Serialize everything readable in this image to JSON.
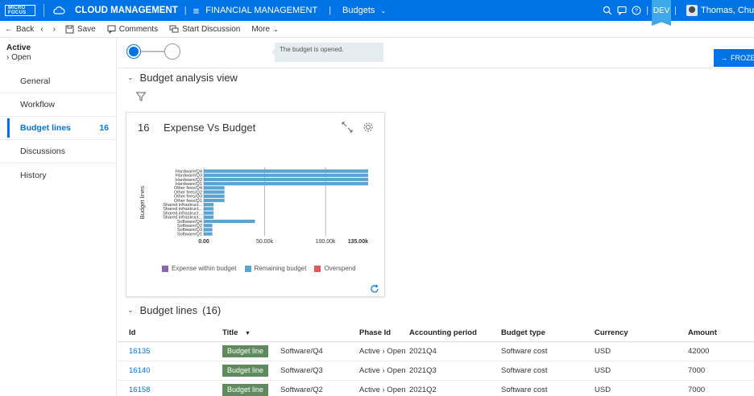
{
  "topbar": {
    "logo_line1": "MICRO",
    "logo_line2": "FOCUS",
    "app_title": "CLOUD MANAGEMENT",
    "module": "FINANCIAL MANAGEMENT",
    "page": "Budgets",
    "env": "DEV",
    "user": "Thomas, Chu",
    "colors": {
      "bar": "#0073e7",
      "env_flag": "#3ea8e8"
    }
  },
  "toolbar": {
    "back": "Back",
    "save": "Save",
    "comments": "Comments",
    "start_discussion": "Start Discussion",
    "more": "More"
  },
  "status": {
    "label": "Active",
    "value": "Open"
  },
  "nav": [
    {
      "label": "General"
    },
    {
      "label": "Workflow"
    },
    {
      "label": "Budget lines",
      "count": "16",
      "active": true
    },
    {
      "label": "Discussions"
    },
    {
      "label": "History"
    }
  ],
  "tooltip": "The budget is opened.",
  "froze_button": "FROZE",
  "analysis": {
    "title": "Budget analysis view"
  },
  "card": {
    "number": "16",
    "title": "Expense Vs Budget"
  },
  "chart_data": {
    "type": "bar",
    "orientation": "horizontal",
    "title": "Expense Vs Budget",
    "ylabel": "Budget lines",
    "categories": [
      "Hardware/Q4",
      "Hardware/Q3",
      "Hardware/Q2",
      "Hardware/Q1",
      "Other fees/Q4",
      "Other fees/Q2",
      "Other fees/Q3",
      "Other fees/Q1",
      "Shared infrastruct...",
      "Shared infrastruct...",
      "Shared infrastruct...",
      "Shared infrastruct...",
      "Software/Q4",
      "Software/Q2",
      "Software/Q3",
      "Software/Q1"
    ],
    "x_ticks": [
      "0.00",
      "50.00k",
      "100.00k",
      "135.00k"
    ],
    "xlim": [
      0,
      135000
    ],
    "grid": true,
    "legend_position": "bottom",
    "series": [
      {
        "name": "Expense within budget",
        "color": "#8c64b4",
        "values": [
          0,
          0,
          0,
          0,
          0,
          0,
          0,
          0,
          0,
          0,
          0,
          0,
          0,
          0,
          0,
          0
        ]
      },
      {
        "name": "Remaining budget",
        "color": "#5ba3d0",
        "values": [
          135000,
          135000,
          135000,
          135000,
          17000,
          17000,
          17000,
          17000,
          8000,
          8000,
          8000,
          8000,
          42000,
          7000,
          7000,
          7000
        ]
      },
      {
        "name": "Overspend",
        "color": "#e05a5a",
        "values": [
          0,
          0,
          0,
          0,
          0,
          0,
          0,
          0,
          0,
          0,
          0,
          0,
          0,
          0,
          0,
          0
        ]
      }
    ]
  },
  "budget_lines": {
    "title": "Budget lines",
    "count": "(16)",
    "columns": [
      "Id",
      "Title",
      "Phase Id",
      "Accounting period",
      "Budget type",
      "Currency",
      "Amount"
    ],
    "badge": "Budget line",
    "rows": [
      {
        "id": "16135",
        "title": "Software/Q4",
        "phase": "Active › Open",
        "period": "2021Q4",
        "type": "Software cost",
        "currency": "USD",
        "amount": "42000"
      },
      {
        "id": "16140",
        "title": "Software/Q3",
        "phase": "Active › Open",
        "period": "2021Q3",
        "type": "Software cost",
        "currency": "USD",
        "amount": "7000"
      },
      {
        "id": "16158",
        "title": "Software/Q2",
        "phase": "Active › Open",
        "period": "2021Q2",
        "type": "Software cost",
        "currency": "USD",
        "amount": "7000"
      }
    ]
  }
}
